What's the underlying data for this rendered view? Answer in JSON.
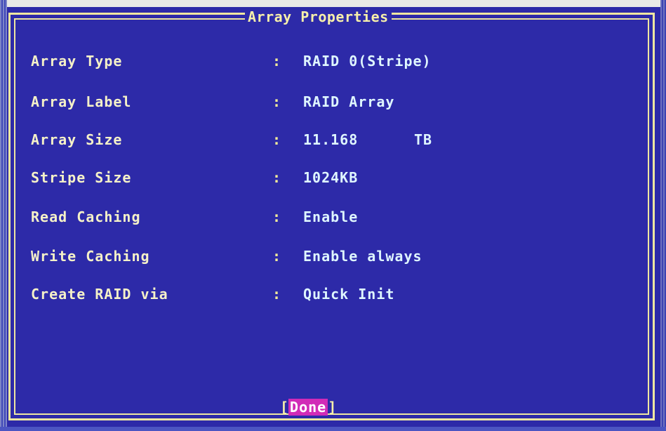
{
  "window": {
    "title": "Array Properties"
  },
  "properties": [
    {
      "label": "Array Type",
      "colon": ":",
      "value": "RAID 0(Stripe)"
    },
    {
      "label": "Array Label",
      "colon": ":",
      "value": "RAID Array"
    },
    {
      "label": "Array Size",
      "colon": ":",
      "value": "11.168",
      "unit": "TB"
    },
    {
      "label": "Stripe Size",
      "colon": ":",
      "value": "1024KB"
    },
    {
      "label": "Read Caching",
      "colon": ":",
      "value": "Enable"
    },
    {
      "label": "Write Caching",
      "colon": ":",
      "value": "Enable always"
    },
    {
      "label": "Create RAID via",
      "colon": ":",
      "value": "Quick Init"
    }
  ],
  "footer": {
    "open_bracket": "[",
    "done_label": "Done",
    "close_bracket": "]"
  },
  "colors": {
    "background": "#2d2aa8",
    "frame": "#efe7a1",
    "label": "#f5f1c8",
    "value": "#dff6ff",
    "button_highlight": "#d12bb7"
  }
}
